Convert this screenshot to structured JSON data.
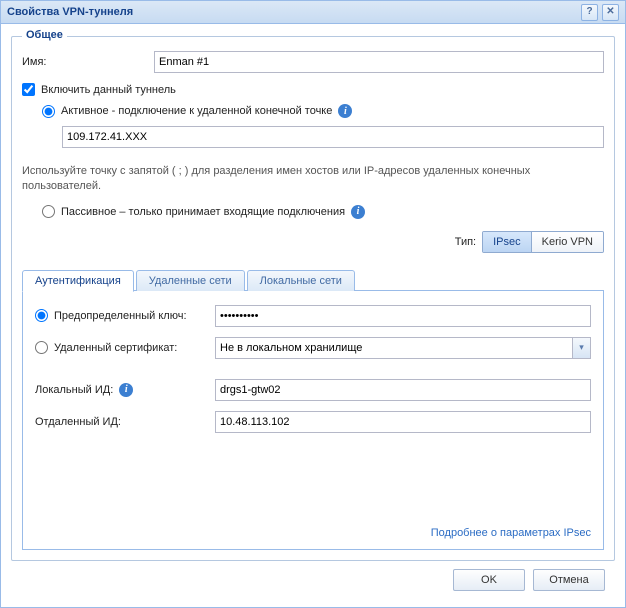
{
  "window": {
    "title": "Свойства VPN-туннеля"
  },
  "general": {
    "legend": "Общее",
    "name_label": "Имя:",
    "name_value": "Enman #1",
    "enable_label": "Включить данный туннель",
    "active_label": "Активное - подключение к удаленной конечной точке",
    "endpoint_value": "109.172.41.XXX",
    "endpoint_hint": "Используйте точку с запятой ( ; ) для разделения имен хостов или IP-адресов удаленных конечных пользователей.",
    "passive_label": "Пассивное – только принимает входящие подключения",
    "type_label": "Тип:",
    "type_ipsec": "IPsec",
    "type_keriovpn": "Kerio VPN"
  },
  "tabs": {
    "auth": "Аутентификация",
    "remote": "Удаленные сети",
    "local": "Локальные сети"
  },
  "auth": {
    "psk_label": "Предопределенный ключ:",
    "psk_value": "••••••••••",
    "cert_label": "Удаленный сертификат:",
    "cert_value": "Не в локальном хранилище",
    "local_id_label": "Локальный ИД:",
    "local_id_value": "drgs1-gtw02",
    "remote_id_label": "Отдаленный ИД:",
    "remote_id_value": "10.48.113.102",
    "more_link": "Подробнее о параметрах IPsec"
  },
  "buttons": {
    "ok": "OK",
    "cancel": "Отмена"
  }
}
